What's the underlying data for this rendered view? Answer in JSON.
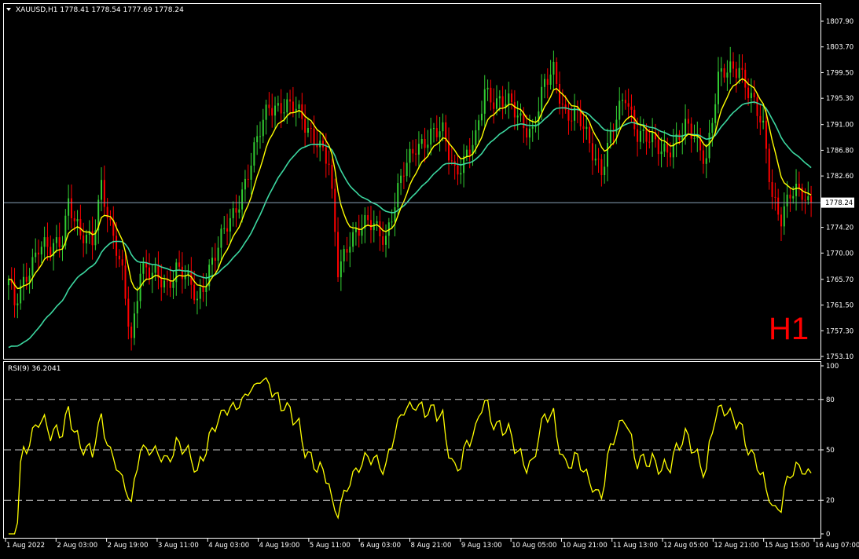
{
  "symbol_header": "XAUUSD,H1  1778.41 1778.54 1777.69 1778.24",
  "watermark": "H1",
  "price_tag": "1778.24",
  "colors": {
    "background": "#000000",
    "frame": "#ffffff",
    "bull_candle": "#32cd32",
    "bear_candle": "#ff0000",
    "ma_fast": "#ffff00",
    "ma_slow": "#3cd7a0",
    "rsi_line": "#ffff00",
    "watermark": "#ff0000",
    "bid_line": "#8aa2b8"
  },
  "chart_data": [
    {
      "type": "line",
      "title": "XAUUSD,H1  1778.41 1778.54 1777.69 1778.24",
      "ylim": [
        1753.1,
        1807.9
      ],
      "y_ticks": [
        "1807.90",
        "1803.70",
        "1799.50",
        "1795.30",
        "1791.00",
        "1786.80",
        "1782.60",
        "1778.24",
        "1774.20",
        "1770.00",
        "1765.70",
        "1761.50",
        "1757.30",
        "1753.10"
      ],
      "x_ticks": [
        "1 Aug 2022",
        "2 Aug 03:00",
        "2 Aug 19:00",
        "3 Aug 11:00",
        "4 Aug 03:00",
        "4 Aug 19:00",
        "5 Aug 11:00",
        "6 Aug 03:00",
        "8 Aug 21:00",
        "9 Aug 13:00",
        "10 Aug 05:00",
        "10 Aug 21:00",
        "11 Aug 13:00",
        "12 Aug 05:00",
        "12 Aug 21:00",
        "15 Aug 15:00",
        "16 Aug 07:00"
      ],
      "current_price": 1778.24,
      "price_anchors": [
        [
          0,
          1765.0
        ],
        [
          2,
          1761.0
        ],
        [
          6,
          1767.0
        ],
        [
          10,
          1771.0
        ],
        [
          14,
          1770.0
        ],
        [
          18,
          1773.0
        ],
        [
          20,
          1779.0
        ],
        [
          24,
          1772.0
        ],
        [
          28,
          1772.0
        ],
        [
          31,
          1782.0
        ],
        [
          34,
          1774.0
        ],
        [
          38,
          1766.0
        ],
        [
          41,
          1756.0
        ],
        [
          44,
          1768.0
        ],
        [
          48,
          1766.0
        ],
        [
          53,
          1765.0
        ],
        [
          56,
          1768.0
        ],
        [
          59,
          1766.0
        ],
        [
          63,
          1762.0
        ],
        [
          67,
          1768.0
        ],
        [
          71,
          1772.0
        ],
        [
          75,
          1776.0
        ],
        [
          79,
          1782.0
        ],
        [
          83,
          1788.0
        ],
        [
          87,
          1794.0
        ],
        [
          91,
          1794.5
        ],
        [
          95,
          1793.5
        ],
        [
          99,
          1791.0
        ],
        [
          103,
          1789.0
        ],
        [
          107,
          1784.0
        ],
        [
          110,
          1767.0
        ],
        [
          114,
          1773.0
        ],
        [
          118,
          1774.0
        ],
        [
          122,
          1774.5
        ],
        [
          126,
          1773.0
        ],
        [
          129,
          1778.0
        ],
        [
          132,
          1783.0
        ],
        [
          136,
          1788.0
        ],
        [
          141,
          1789.0
        ],
        [
          145,
          1789.5
        ],
        [
          149,
          1784.0
        ],
        [
          152,
          1785.0
        ],
        [
          156,
          1788.0
        ],
        [
          159,
          1797.0
        ],
        [
          163,
          1795.0
        ],
        [
          167,
          1794.0
        ],
        [
          171,
          1792.0
        ],
        [
          175,
          1790.0
        ],
        [
          179,
          1797.0
        ],
        [
          182,
          1800.0
        ],
        [
          186,
          1793.0
        ],
        [
          190,
          1792.0
        ],
        [
          194,
          1788.0
        ],
        [
          198,
          1784.0
        ],
        [
          202,
          1790.0
        ],
        [
          206,
          1796.0
        ],
        [
          210,
          1790.0
        ],
        [
          214,
          1788.0
        ],
        [
          218,
          1787.0
        ],
        [
          222,
          1788.0
        ],
        [
          226,
          1790.0
        ],
        [
          229,
          1789.0
        ],
        [
          233,
          1786.0
        ],
        [
          237,
          1798.0
        ],
        [
          241,
          1800.0
        ],
        [
          244,
          1801.0
        ],
        [
          248,
          1795.0
        ],
        [
          252,
          1790.0
        ],
        [
          255,
          1780.0
        ],
        [
          258,
          1776.0
        ],
        [
          261,
          1779.0
        ],
        [
          265,
          1780.0
        ],
        [
          268,
          1778.2
        ]
      ],
      "series": [
        {
          "values_source": "candles",
          "type": "candlestick"
        },
        {
          "values_source": "ma_fast",
          "type": "line"
        },
        {
          "values_source": "ma_slow",
          "type": "line"
        }
      ]
    },
    {
      "type": "line",
      "title": "RSI(9) 36.2041",
      "ylim": [
        0,
        100
      ],
      "y_ticks": [
        "100",
        "80",
        "50",
        "20",
        "0"
      ],
      "levels": [
        80,
        50,
        20
      ],
      "current_value": 36.2041
    }
  ]
}
